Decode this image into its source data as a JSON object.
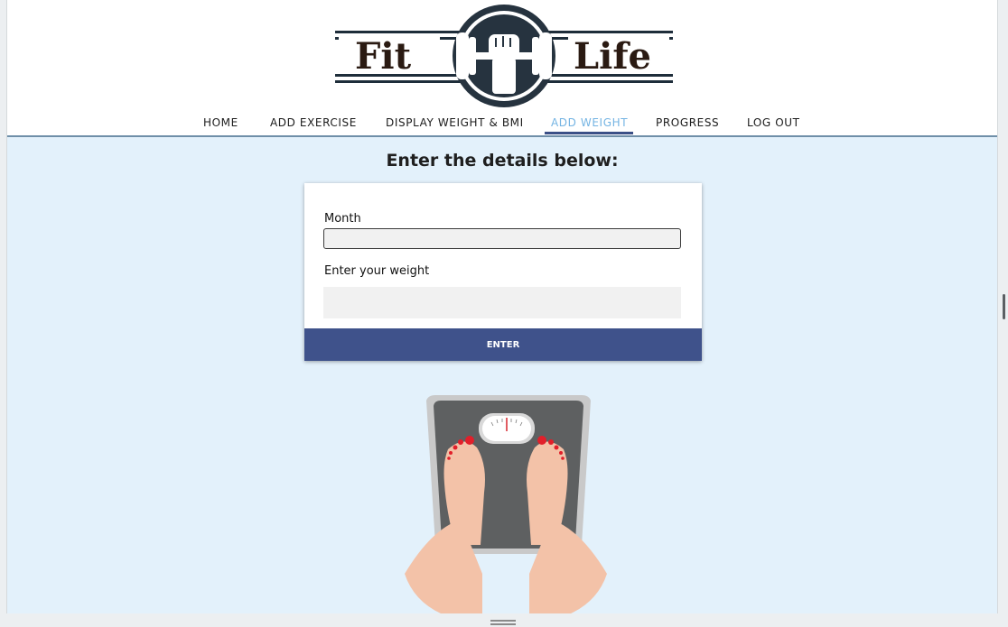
{
  "brand": {
    "logo_text_left": "Fit",
    "logo_text_right": "Life"
  },
  "nav": {
    "items": [
      {
        "label": "HOME",
        "active": false
      },
      {
        "label": "ADD EXERCISE",
        "active": false
      },
      {
        "label": "DISPLAY WEIGHT & BMI",
        "active": false
      },
      {
        "label": "ADD WEIGHT",
        "active": true
      },
      {
        "label": "PROGRESS",
        "active": false
      },
      {
        "label": "LOG OUT",
        "active": false
      }
    ]
  },
  "main": {
    "heading": "Enter the details below:",
    "form": {
      "month_label": "Month",
      "month_value": "",
      "weight_label": "Enter your weight",
      "weight_value": "",
      "submit_label": "ENTER"
    }
  },
  "colors": {
    "page_bg": "#e3f1fb",
    "nav_active": "#74b4e3",
    "button_bg": "#3f528b",
    "nav_underline": "#3b4f86"
  }
}
